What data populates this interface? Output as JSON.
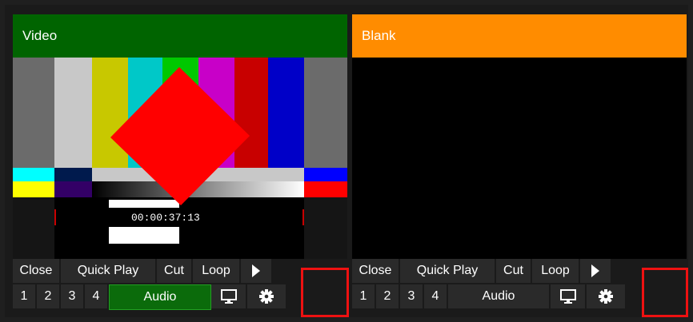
{
  "panels": [
    {
      "title": "Video",
      "title_color": "#006400",
      "timecode": "00:00:37:13",
      "buttons_row1": [
        "Close",
        "Quick Play",
        "Cut",
        "Loop"
      ],
      "buttons_row2": [
        "1",
        "2",
        "3",
        "4",
        "Audio"
      ],
      "audio_active": true
    },
    {
      "title": "Blank",
      "title_color": "#ff8c00",
      "buttons_row1": [
        "Close",
        "Quick Play",
        "Cut",
        "Loop"
      ],
      "buttons_row2": [
        "1",
        "2",
        "3",
        "4",
        "Audio"
      ],
      "audio_active": false
    }
  ],
  "icons": {
    "play": "play-icon",
    "monitor": "monitor-icon",
    "settings": "gear-icon"
  },
  "highlight_color": "#ee1111"
}
